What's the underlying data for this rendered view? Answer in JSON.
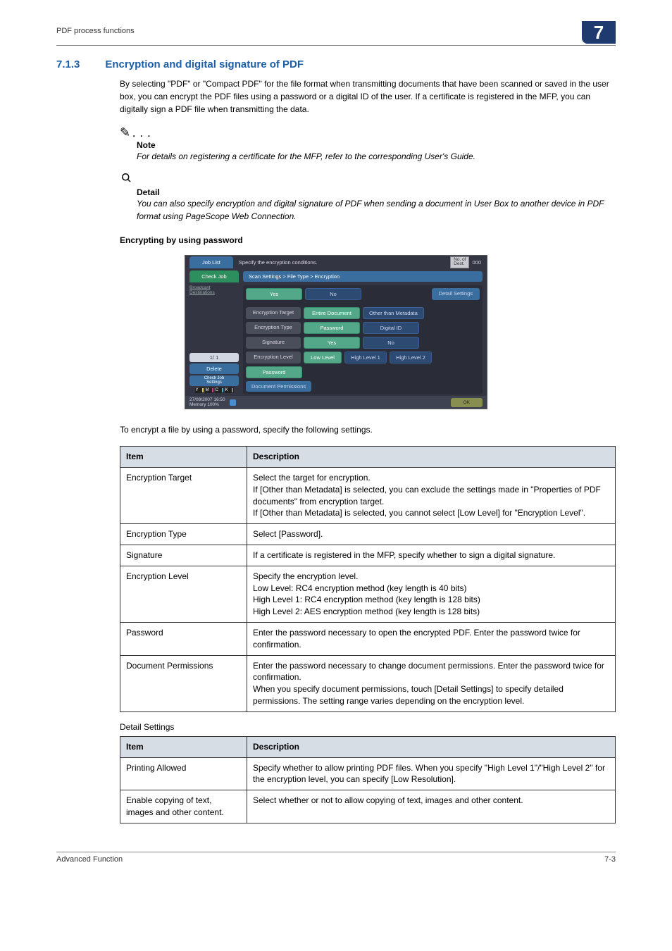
{
  "header": {
    "left": "PDF process functions",
    "badge": "7"
  },
  "section": {
    "num": "7.1.3",
    "title": "Encryption and digital signature of PDF"
  },
  "intro": "By selecting \"PDF\" or \"Compact PDF\" for the file format when transmitting documents that have been scanned or saved in the user box, you can encrypt the PDF files using a password or a digital ID of the user. If a certificate is registered in the MFP, you can digitally sign a PDF file when transmitting the data.",
  "note": {
    "title": "Note",
    "body": "For details on registering a certificate for the MFP, refer to the corresponding User's Guide."
  },
  "detail": {
    "title": "Detail",
    "body": "You can also specify encryption and digital signature of PDF when sending a document in User Box to another device in PDF format using PageScope Web Connection."
  },
  "enc_heading": "Encrypting by using password",
  "ui": {
    "job_list": "Job List",
    "instruction": "Specify the encryption conditions.",
    "dest_label": "No. of\nDest.",
    "dest_count": "000",
    "check_job": "Check Job",
    "breadcrumb": "Scan Settings > File Type > Encryption",
    "broadcast": "Broadcast\nDestinations",
    "yes": "Yes",
    "no": "No",
    "detail_settings": "Detail Settings",
    "rows": {
      "enc_target": "Encryption Target",
      "entire_doc": "Entire Document",
      "other_meta": "Other than Metadata",
      "enc_type": "Encryption Type",
      "password": "Password",
      "digital_id": "Digital ID",
      "signature": "Signature",
      "enc_level": "Encryption Level",
      "low": "Low Level",
      "high1": "High Level 1",
      "high2": "High Level 2",
      "pwd_btn": "Password",
      "doc_perm": "Document Permissions"
    },
    "pager": "1/  1",
    "delete": "Delete",
    "check_job_settings": "Check Job\nSettings",
    "date": "27/09/2007   16:50",
    "memory": "Memory        100%",
    "ok": "OK"
  },
  "after_ui": "To encrypt a file by using a password, specify the following settings.",
  "table1": {
    "h1": "Item",
    "h2": "Description",
    "rows": [
      {
        "item": "Encryption Target",
        "desc": "Select the target for encryption.\nIf [Other than Metadata] is selected, you can exclude the settings made in \"Properties of PDF documents\" from encryption target.\nIf [Other than Metadata] is selected, you cannot select [Low Level] for \"Encryption Level\"."
      },
      {
        "item": "Encryption Type",
        "desc": "Select [Password]."
      },
      {
        "item": "Signature",
        "desc": "If a certificate is registered in the MFP, specify whether to sign a digital signature."
      },
      {
        "item": "Encryption Level",
        "desc": "Specify the encryption level.\nLow Level: RC4 encryption method (key length is 40 bits)\nHigh Level 1: RC4 encryption method (key length is 128 bits)\nHigh Level 2: AES encryption method (key length is 128 bits)"
      },
      {
        "item": "Password",
        "desc": "Enter the password necessary to open the encrypted PDF. Enter the password twice for confirmation."
      },
      {
        "item": "Document Permissions",
        "desc": "Enter the password necessary to change document permissions. Enter the password twice for confirmation.\nWhen you specify document permissions, touch [Detail Settings] to specify detailed permissions. The setting range varies depending on the encryption level."
      }
    ]
  },
  "detail_caption": "Detail Settings",
  "table2": {
    "h1": "Item",
    "h2": "Description",
    "rows": [
      {
        "item": "Printing Allowed",
        "desc": "Specify whether to allow printing PDF files. When you specify \"High Level 1\"/\"High Level 2\" for the encryption level, you can specify [Low Resolution]."
      },
      {
        "item": "Enable copying of text, images and other content.",
        "desc": "Select whether or not to allow copying of text, images and other content."
      }
    ]
  },
  "footer": {
    "left": "Advanced Function",
    "right": "7-3"
  }
}
